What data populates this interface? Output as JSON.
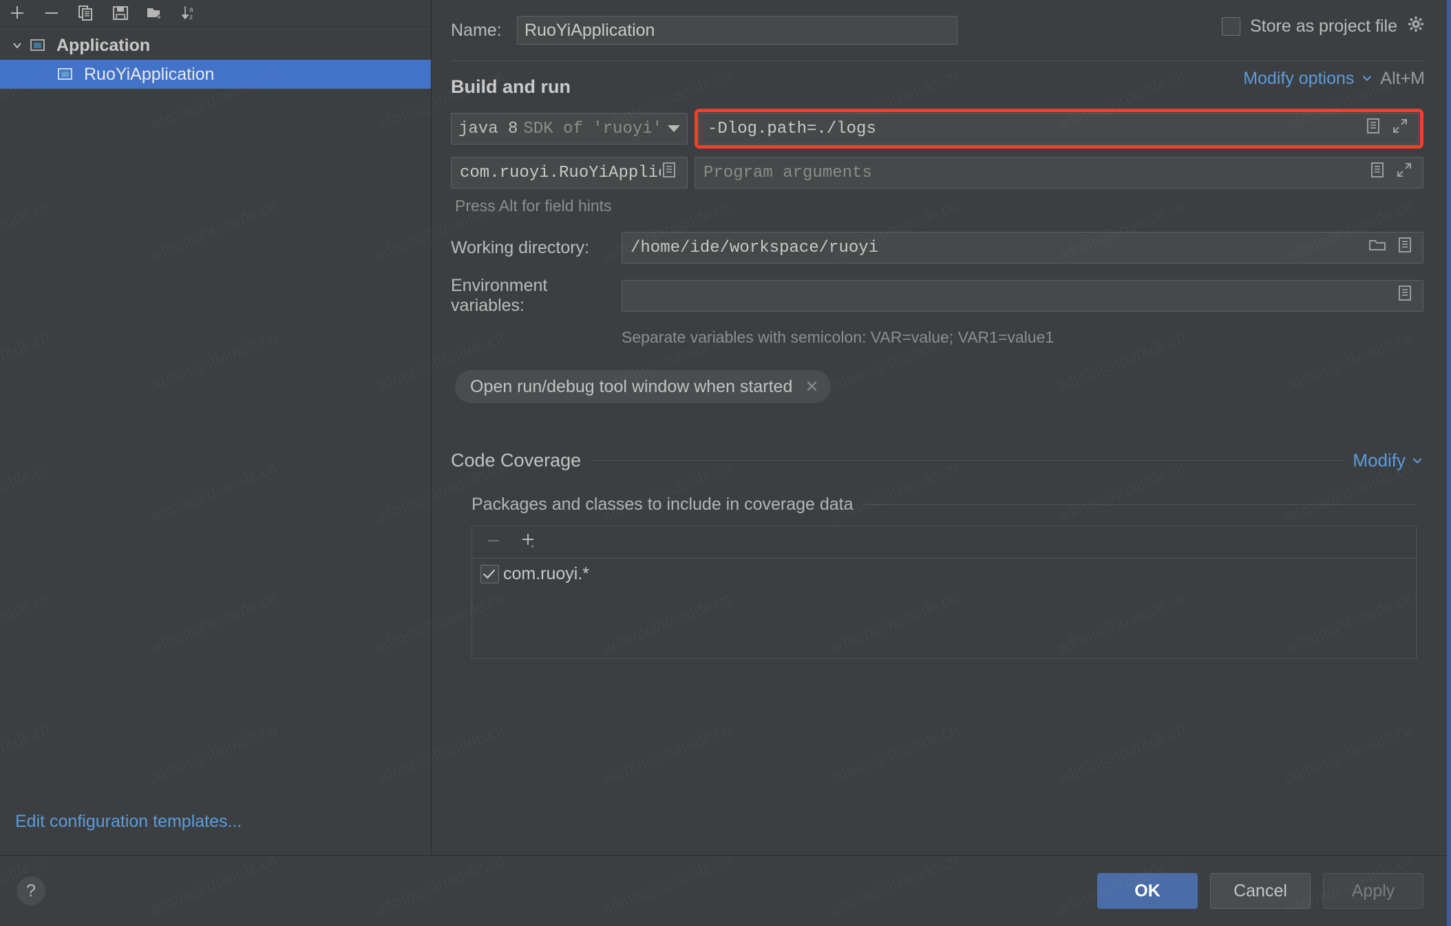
{
  "sidebar": {
    "toolbar": [
      {
        "name": "add-configuration-icon",
        "label": "Add New Configuration"
      },
      {
        "name": "remove-configuration-icon",
        "label": "Remove Configuration"
      },
      {
        "name": "copy-configuration-icon",
        "label": "Copy Configuration"
      },
      {
        "name": "save-configuration-icon",
        "label": "Save Configuration"
      },
      {
        "name": "new-folder-icon",
        "label": "Create New Folder"
      },
      {
        "name": "sort-alphabetically-icon",
        "label": "Sort Configurations"
      }
    ],
    "tree": {
      "group_label": "Application",
      "child_label": "RuoYiApplication"
    },
    "edit_templates_link": "Edit configuration templates..."
  },
  "main": {
    "name_label": "Name:",
    "name_value": "RuoYiApplication",
    "store_as_project_file": "Store as project file",
    "store_as_project_file_checked": false,
    "build_and_run": {
      "title": "Build and run",
      "modify_options_link": "Modify options",
      "modify_options_shortcut": "Alt+M",
      "jdk_primary": "java 8",
      "jdk_secondary": "SDK of 'ruoyi' mod",
      "vm_options_value": "-Dlog.path=./logs",
      "vm_options_highlighted": true,
      "main_class_value": "com.ruoyi.RuoYiApplication",
      "program_arguments_placeholder": "Program arguments",
      "field_hint": "Press Alt for field hints"
    },
    "working_directory_label": "Working directory:",
    "working_directory_value": "/home/ide/workspace/ruoyi",
    "environment_variables_label": "Environment variables:",
    "environment_variables_value": "",
    "environment_note": "Separate variables with semicolon: VAR=value; VAR1=value1",
    "chip_label": "Open run/debug tool window when started",
    "code_coverage": {
      "title": "Code Coverage",
      "modify_link": "Modify",
      "subtitle": "Packages and classes to include in coverage data",
      "items": [
        {
          "label": "com.ruoyi.*",
          "checked": true
        }
      ]
    }
  },
  "footer": {
    "help_label": "?",
    "ok_label": "OK",
    "cancel_label": "Cancel",
    "apply_label": "Apply",
    "apply_disabled": true
  },
  "watermark_text": "admin@itianide.cn",
  "colors": {
    "background": "#3c3f41",
    "selection_blue": "#4273c8",
    "link_blue": "#5c9cdc",
    "highlight_red": "#f0402a",
    "primary_button": "#4a6da7"
  }
}
